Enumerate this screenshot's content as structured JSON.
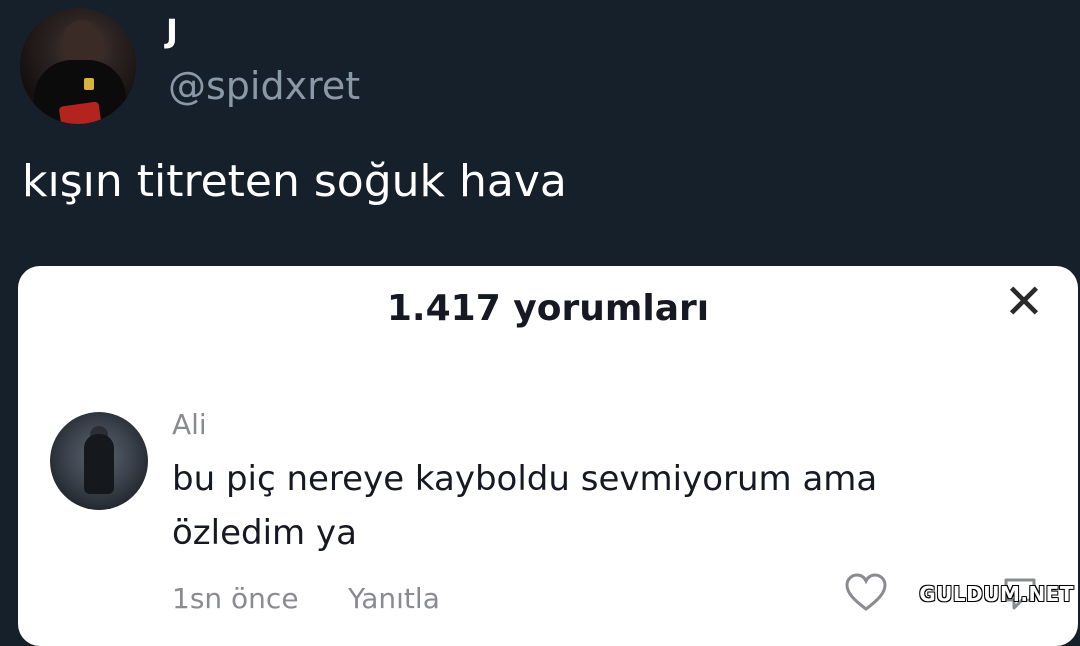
{
  "tweet": {
    "display_name": "J",
    "handle": "@spidxret",
    "text": "kışın titreten soğuk hava"
  },
  "comments_panel": {
    "title": "1.417 yorumları",
    "close_icon": "close-icon",
    "comment": {
      "author": "Ali",
      "text": "bu piç nereye kayboldu sevmiyorum ama özledim ya",
      "time": "1sn önce",
      "reply_label": "Yanıtla",
      "like_icon": "heart-icon",
      "dislike_icon": "dislike-icon"
    }
  },
  "watermark": "GULDUM.NET",
  "colors": {
    "background": "#15202b",
    "handle_gray": "#8b98a5",
    "card_bg": "#ffffff",
    "meta_gray": "#8a8b91"
  }
}
